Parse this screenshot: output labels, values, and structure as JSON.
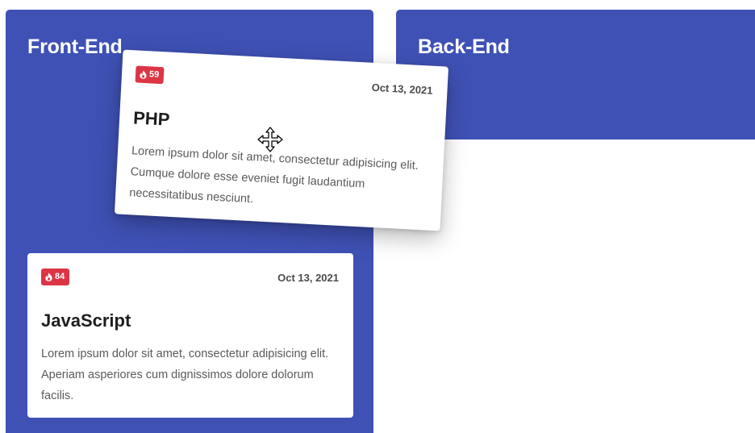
{
  "columns": {
    "front_end": {
      "title": "Front-End"
    },
    "back_end": {
      "title": "Back-End"
    }
  },
  "colors": {
    "column_bg": "#3f51b5",
    "badge_bg": "#dc3545",
    "card_bg": "#ffffff"
  },
  "cards": {
    "javascript": {
      "badge_icon": "flame-icon",
      "badge_count": "84",
      "date": "Oct 13, 2021",
      "title": "JavaScript",
      "body": "Lorem ipsum dolor sit amet, consectetur adipisicing elit. Aperiam asperiores cum dignissimos dolore dolorum facilis."
    },
    "php": {
      "badge_icon": "flame-icon",
      "badge_count": "59",
      "date": "Oct 13, 2021",
      "title": "PHP",
      "body": "Lorem ipsum dolor sit amet, consectetur adipisicing elit. Cumque dolore esse eveniet fugit laudantium necessitatibus nesciunt.",
      "state": "dragging"
    }
  },
  "cursor": {
    "icon": "move-cursor-icon"
  }
}
